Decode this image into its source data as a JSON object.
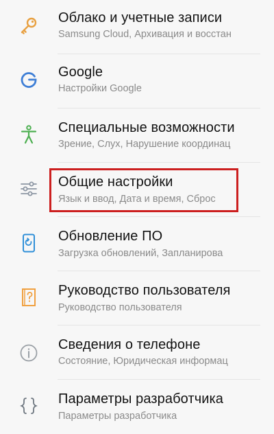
{
  "settings_list": {
    "items": [
      {
        "title": "Облако и учетные записи",
        "subtitle": "Samsung Cloud, Архивация и восстан",
        "icon": "key-icon",
        "icon_color": "#e8a040"
      },
      {
        "title": "Google",
        "subtitle": "Настройки Google",
        "icon": "google-g-icon",
        "icon_color": "#3f7fd6"
      },
      {
        "title": "Специальные возможности",
        "subtitle": "Зрение, Слух, Нарушение координац",
        "icon": "accessibility-person-icon",
        "icon_color": "#4caf50"
      },
      {
        "title": "Общие настройки",
        "subtitle": "Язык и ввод, Дата и время, Сброс",
        "icon": "sliders-icon",
        "icon_color": "#8c96a3",
        "highlighted": true,
        "highlight_color": "#cc1f1f"
      },
      {
        "title": "Обновление ПО",
        "subtitle": "Загрузка обновлений, Запланирова",
        "icon": "software-update-icon",
        "icon_color": "#2f8fd8"
      },
      {
        "title": "Руководство пользователя",
        "subtitle": "Руководство пользователя",
        "icon": "user-manual-icon",
        "icon_color": "#f0a040"
      },
      {
        "title": "Сведения о телефоне",
        "subtitle": "Состояние, Юридическая информац",
        "icon": "info-icon",
        "icon_color": "#9aa0a6"
      },
      {
        "title": "Параметры разработчика",
        "subtitle": "Параметры разработчика",
        "icon": "developer-braces-icon",
        "icon_color": "#6e7780"
      }
    ]
  }
}
